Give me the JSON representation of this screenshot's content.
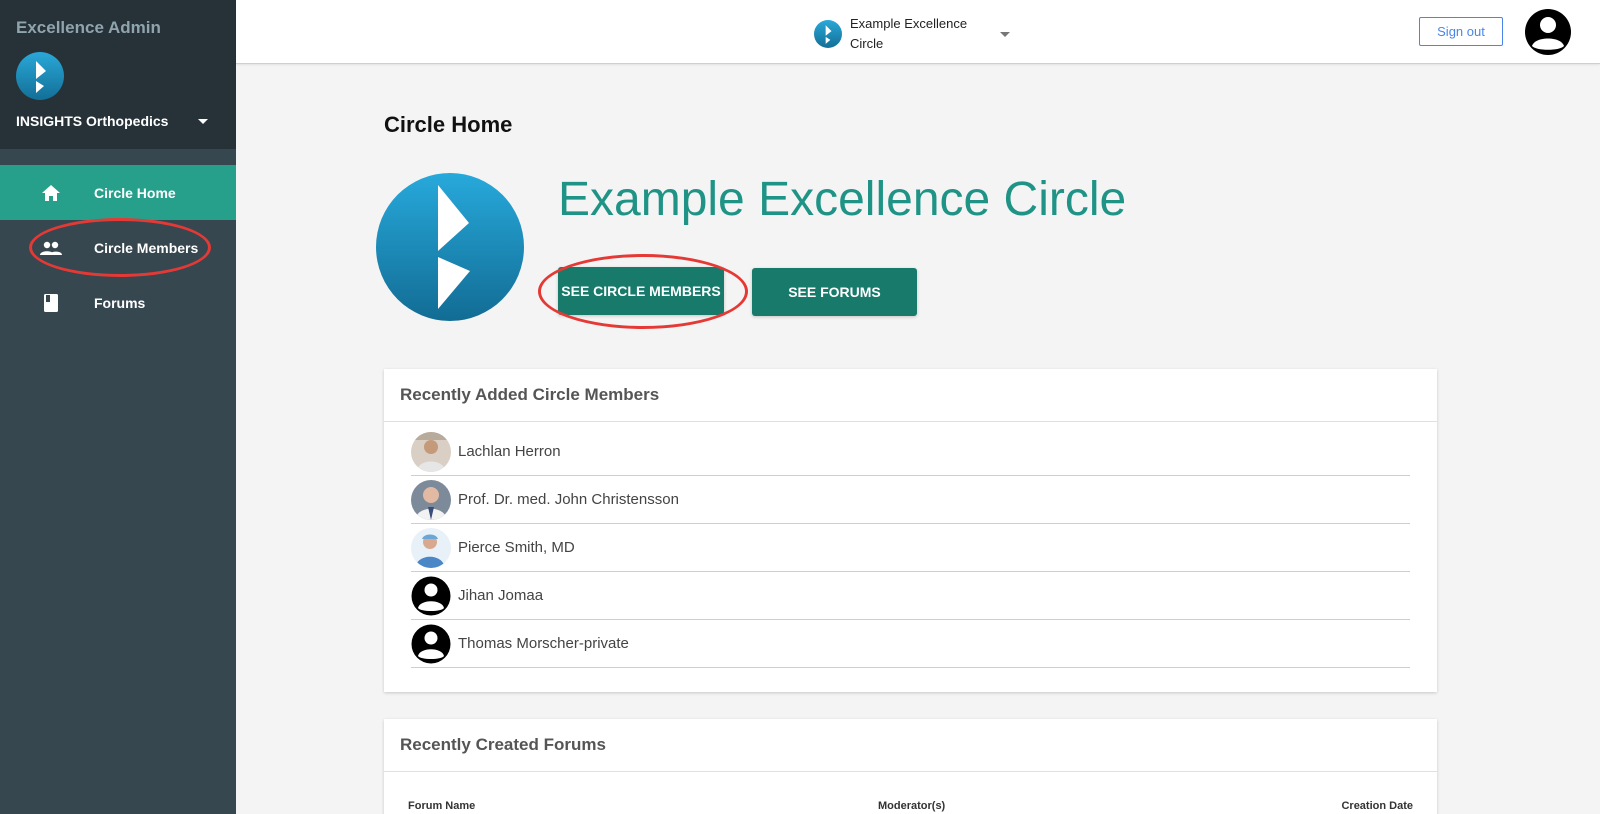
{
  "sidebar": {
    "app_title": "Excellence Admin",
    "org_name": "INSIGHTS Orthopedics",
    "items": [
      {
        "label": "Circle Home",
        "icon": "home-icon",
        "active": true
      },
      {
        "label": "Circle Members",
        "icon": "people-icon",
        "active": false
      },
      {
        "label": "Forums",
        "icon": "book-icon",
        "active": false
      }
    ]
  },
  "topbar": {
    "circle_name": "Example Excellence Circle",
    "signout_label": "Sign out"
  },
  "main": {
    "page_title": "Circle Home",
    "circle_title": "Example Excellence Circle",
    "see_members_label": "SEE CIRCLE MEMBERS",
    "see_forums_label": "SEE FORUMS",
    "members_card": {
      "title": "Recently Added Circle Members",
      "members": [
        {
          "name": "Lachlan Herron",
          "avatar": "photo"
        },
        {
          "name": "Prof. Dr. med. John Christensson",
          "avatar": "photo"
        },
        {
          "name": "Pierce Smith, MD",
          "avatar": "photo"
        },
        {
          "name": "Jihan Jomaa",
          "avatar": "default"
        },
        {
          "name": "Thomas Morscher-private",
          "avatar": "default"
        }
      ]
    },
    "forums_card": {
      "title": "Recently Created Forums",
      "columns": [
        "Forum Name",
        "Moderator(s)",
        "Creation Date"
      ]
    }
  },
  "colors": {
    "accent": "#26a08a",
    "button": "#177a6b",
    "title": "#1f9486",
    "sidebar": "#37474f",
    "sidebar_head": "#263238",
    "annotation": "#e53935"
  }
}
